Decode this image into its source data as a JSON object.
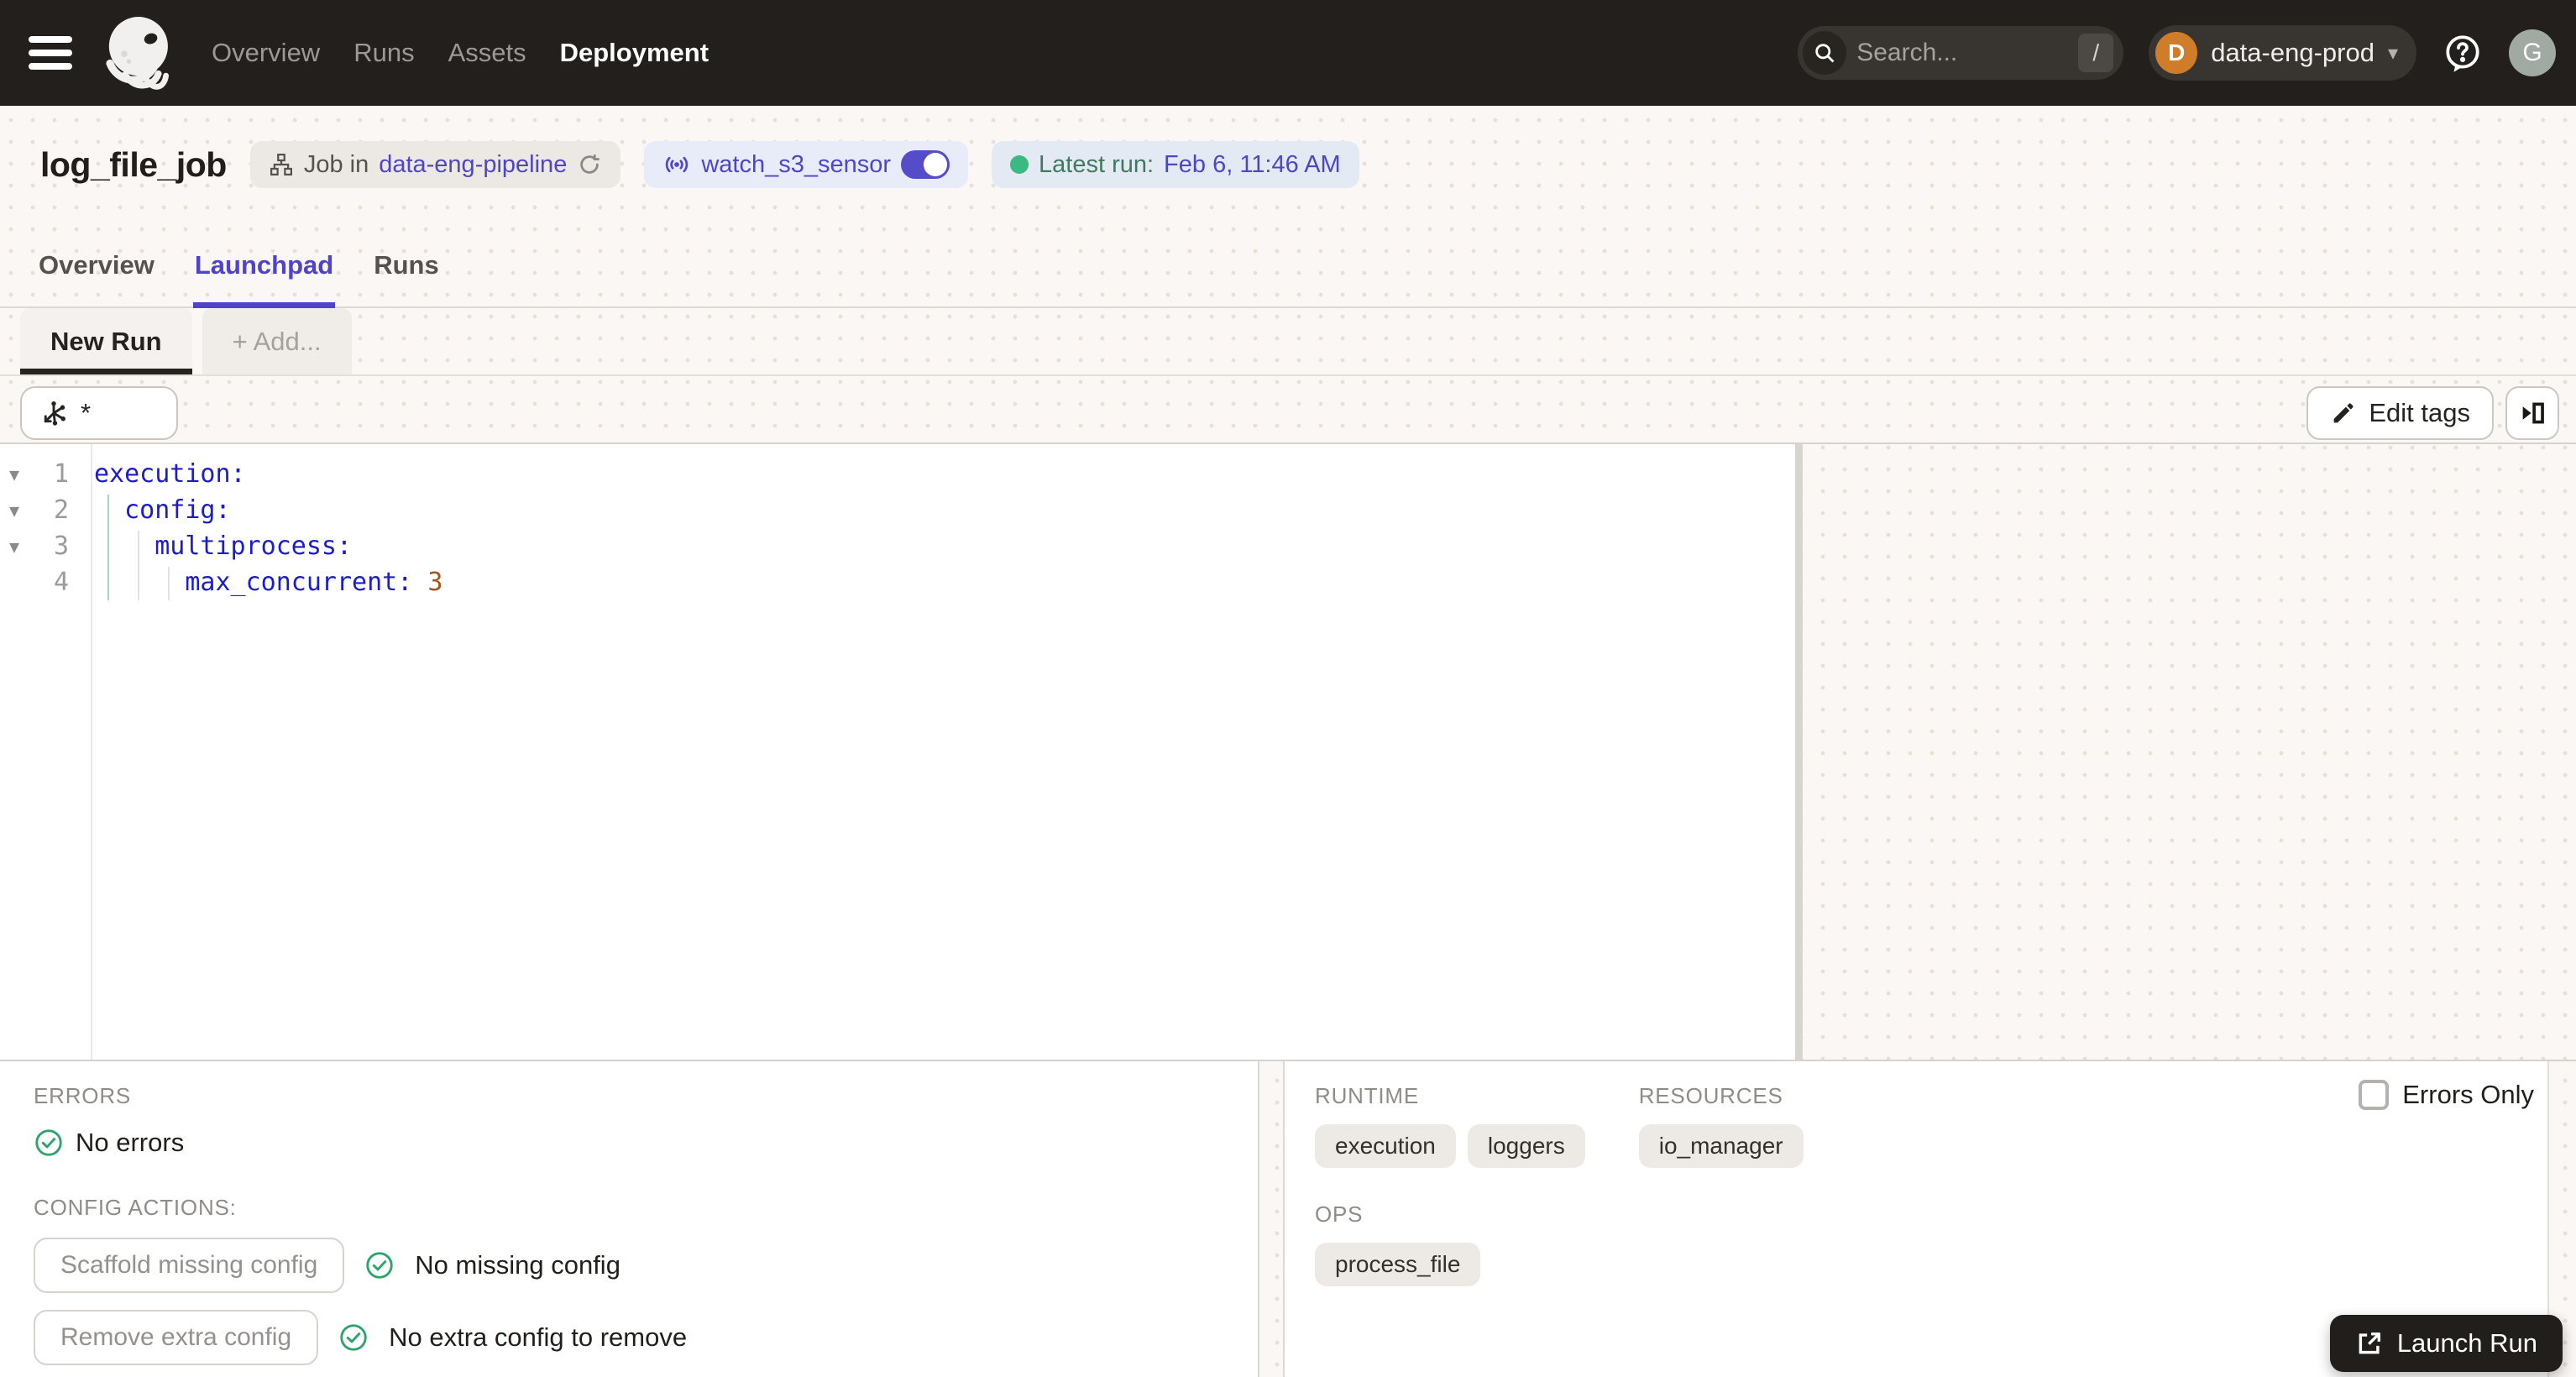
{
  "nav": {
    "items": [
      {
        "label": "Overview",
        "active": false
      },
      {
        "label": "Runs",
        "active": false
      },
      {
        "label": "Assets",
        "active": false
      },
      {
        "label": "Deployment",
        "active": true
      }
    ],
    "search": {
      "placeholder": "Search...",
      "shortcut": "/"
    },
    "deployment_switcher": {
      "initial": "D",
      "name": "data-eng-prod"
    },
    "user_initial": "G"
  },
  "header": {
    "title": "log_file_job",
    "job_badge": {
      "prefix": "Job in",
      "repo_link": "data-eng-pipeline"
    },
    "sensor_badge": {
      "name": "watch_s3_sensor"
    },
    "latest_run_badge": {
      "label": "Latest run:",
      "value": "Feb 6, 11:46 AM"
    }
  },
  "tabs": [
    {
      "label": "Overview",
      "active": false
    },
    {
      "label": "Launchpad",
      "active": true
    },
    {
      "label": "Runs",
      "active": false
    }
  ],
  "run_tabs": {
    "new_run": "New Run",
    "add": "+ Add..."
  },
  "toolbar": {
    "op_selection_value": "*",
    "edit_tags_label": "Edit tags"
  },
  "editor": {
    "lines": [
      {
        "num": "1",
        "text": "execution:"
      },
      {
        "num": "2",
        "text": "  config:"
      },
      {
        "num": "3",
        "text": "    multiprocess:"
      },
      {
        "num": "4",
        "text": "      max_concurrent: ",
        "value": "3"
      }
    ]
  },
  "bottom_left": {
    "errors_heading": "ERRORS",
    "no_errors_text": "No errors",
    "config_actions_heading": "CONFIG ACTIONS:",
    "actions": [
      {
        "button_label": "Scaffold missing config",
        "status_text": "No missing config"
      },
      {
        "button_label": "Remove extra config",
        "status_text": "No extra config to remove"
      }
    ]
  },
  "bottom_right": {
    "errors_only_label": "Errors Only",
    "runtime": {
      "heading": "RUNTIME",
      "tags": [
        "execution",
        "loggers"
      ]
    },
    "resources": {
      "heading": "RESOURCES",
      "tags": [
        "io_manager"
      ]
    },
    "ops": {
      "heading": "OPS",
      "tags": [
        "process_file"
      ]
    },
    "launch_button_label": "Launch Run"
  },
  "colors": {
    "nav_background": "#231f1d",
    "accent_indigo": "#4f46c5",
    "success_green": "#2ba36b",
    "latest_run_green": "#3cb881",
    "yaml_key_blue": "#1d1dc8",
    "yaml_number_orange": "#a4551d",
    "deployment_avatar_orange": "#d07d2a",
    "page_background": "#faf7f4"
  }
}
